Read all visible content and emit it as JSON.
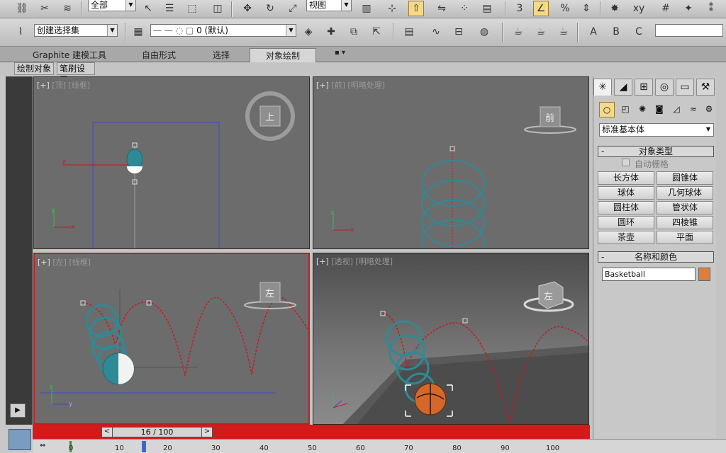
{
  "toolbar1": {
    "selection_filter": "全部",
    "ref_coord": "视图"
  },
  "toolbar2": {
    "named_selection": "创建选择集",
    "layer": "0 (默认)"
  },
  "ribbon": {
    "tabs": [
      "Graphite 建模工具",
      "自由形式",
      "选择",
      "对象绘制"
    ],
    "active_tab": "对象绘制",
    "subtabs": [
      "绘制对象",
      "笔刷设置"
    ]
  },
  "viewports": [
    {
      "name": "top",
      "label_plus": "[+]",
      "label_view": "[顶]",
      "label_mode": "[线框]",
      "cube": "上"
    },
    {
      "name": "front",
      "label_plus": "[+]",
      "label_view": "[前]",
      "label_mode": "[明暗处理]",
      "cube": "前"
    },
    {
      "name": "left",
      "label_plus": "[+]",
      "label_view": "[左]",
      "label_mode": "[线框]",
      "cube": "左"
    },
    {
      "name": "perspective",
      "label_plus": "[+]",
      "label_view": "[透视]",
      "label_mode": "[明暗处理]",
      "cube": "左"
    }
  ],
  "command_panel": {
    "category": "标准基本体",
    "object_type_title": "对象类型",
    "autogrid": "自动栅格",
    "objects": [
      "长方体",
      "圆锥体",
      "球体",
      "几何球体",
      "圆柱体",
      "管状体",
      "圆环",
      "四棱锥",
      "茶壶",
      "平面"
    ],
    "name_color_title": "名称和颜色",
    "object_name": "Basketball",
    "object_color": "#e07d3c"
  },
  "timeline": {
    "frame_display": "16 / 100",
    "prev": "<",
    "next": ">",
    "ruler_labels": [
      "0",
      "10",
      "20",
      "30",
      "40",
      "50",
      "60",
      "70",
      "80",
      "90",
      "100"
    ]
  },
  "colors": {
    "active_border": "#c8191f",
    "trajectory": "#c8191f",
    "ball_wire": "#2e8a95",
    "time_bar": "#d31a1a"
  }
}
